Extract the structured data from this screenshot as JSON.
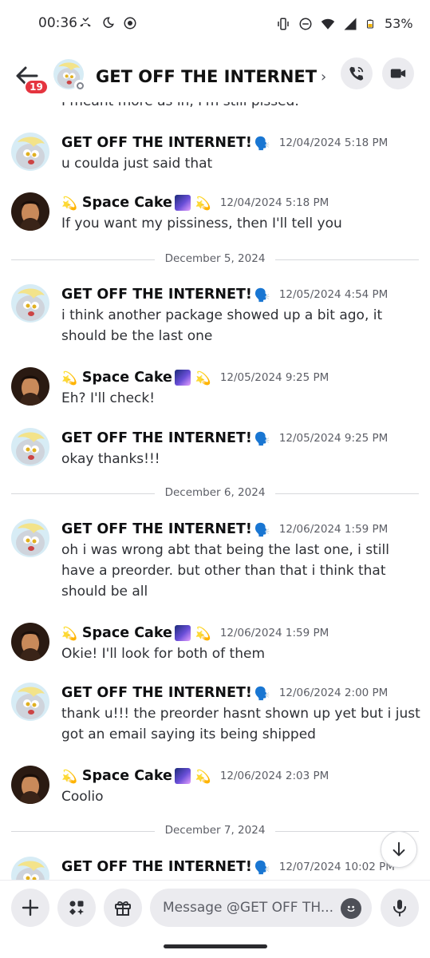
{
  "status_bar": {
    "time": "00:36",
    "battery": "53%",
    "icons_left": [
      "missed-call-icon",
      "moon-icon",
      "camera-dot-icon"
    ],
    "icons_right": [
      "vibrate-icon",
      "dnd-icon",
      "wifi-icon",
      "signal-icon",
      "battery-icon"
    ]
  },
  "header": {
    "title": "GET OFF THE INTERNET! ...",
    "unread_badge": "19",
    "chevron": "›"
  },
  "chat": {
    "partial_top_message": "I meant more as in, I'm still pissed.",
    "messages": [
      {
        "author": "GET OFF THE INTERNET!",
        "emoji": "🗣️",
        "time": "12/04/2024 5:18 PM",
        "text": "u coulda just said that"
      },
      {
        "author": "Space Cake",
        "emoji_left": "💫",
        "emoji_right": "💫",
        "time": "12/04/2024 5:18 PM",
        "text": "If you want my pissiness, then I'll tell you"
      },
      {
        "author": "GET OFF THE INTERNET!",
        "emoji": "🗣️",
        "time": "12/05/2024 4:54 PM",
        "text": "i think another package showed up a bit ago, it should be the last one"
      },
      {
        "author": "Space Cake",
        "emoji_left": "💫",
        "emoji_right": "💫",
        "time": "12/05/2024 9:25 PM",
        "text": "Eh? I'll check!"
      },
      {
        "author": "GET OFF THE INTERNET!",
        "emoji": "🗣️",
        "time": "12/05/2024 9:25 PM",
        "text": "okay thanks!!!"
      },
      {
        "author": "GET OFF THE INTERNET!",
        "emoji": "🗣️",
        "time": "12/06/2024 1:59 PM",
        "text": "oh i was wrong abt that being the last one, i still have a preorder. but other than that i think that should be all"
      },
      {
        "author": "Space Cake",
        "emoji_left": "💫",
        "emoji_right": "💫",
        "time": "12/06/2024 1:59 PM",
        "text": "Okie! I'll look for both of them"
      },
      {
        "author": "GET OFF THE INTERNET!",
        "emoji": "🗣️",
        "time": "12/06/2024 2:00 PM",
        "text": "thank u!!! the preorder hasnt shown up yet but i just got an email saying its being shipped"
      },
      {
        "author": "Space Cake",
        "emoji_left": "💫",
        "emoji_right": "💫",
        "time": "12/06/2024 2:03 PM",
        "text": "Coolio"
      },
      {
        "author": "GET OFF THE INTERNET!",
        "emoji": "🗣️",
        "time": "12/07/2024 10:02 PM",
        "text": ""
      }
    ],
    "dividers": [
      "December 5, 2024",
      "December 6, 2024",
      "December 7, 2024"
    ]
  },
  "composer": {
    "placeholder": "Message @GET OFF TH..."
  },
  "colors": {
    "badge": "#e5343f",
    "button_bg": "#ebebef",
    "timestamp": "#5c5e66"
  }
}
